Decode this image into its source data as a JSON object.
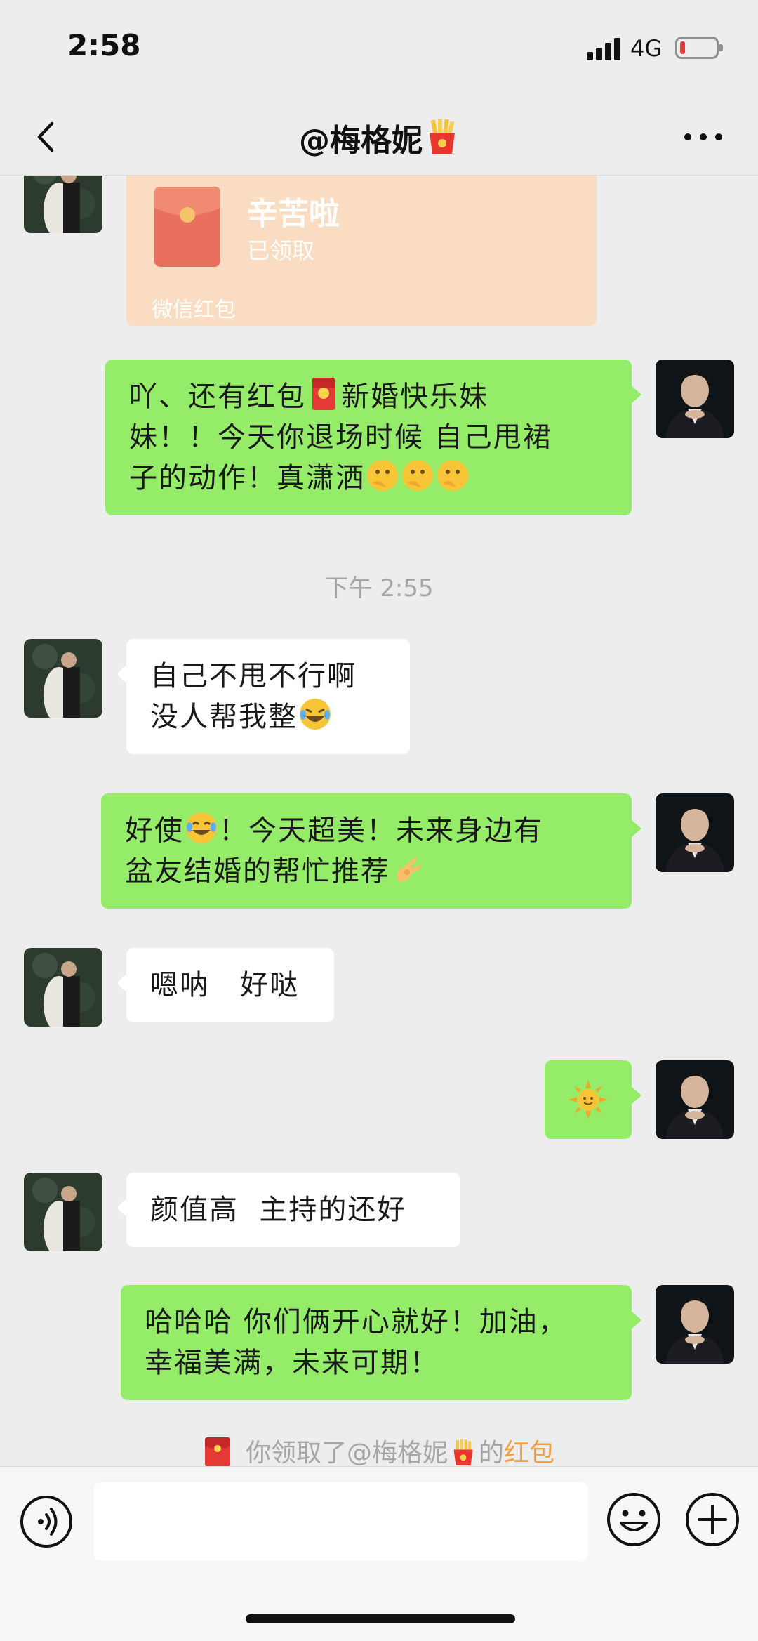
{
  "status_bar": {
    "time": "2:58",
    "network": "4G"
  },
  "nav": {
    "title": "@梅格妮"
  },
  "red_packet": {
    "title": "辛苦啦",
    "status": "已领取",
    "footer": "微信红包"
  },
  "messages": [
    {
      "dir": "out",
      "lines": [
        "吖、还有红包",
        "新婚快乐妹",
        "妹！！今天你退场时候 自己甩裙",
        "子的动作！真潇洒"
      ]
    },
    {
      "dir": "in",
      "lines": [
        "自己不甩不行啊",
        "没人帮我整"
      ]
    },
    {
      "dir": "out",
      "lines": [
        "好使",
        "！今天超美！未来身边有",
        "盆友结婚的帮忙推荐"
      ]
    },
    {
      "dir": "in",
      "lines": [
        "嗯呐   好哒"
      ]
    },
    {
      "dir": "in",
      "lines": [
        "颜值高  主持的还好"
      ]
    },
    {
      "dir": "out",
      "lines": [
        "哈哈哈 你们俩开心就好！加油，",
        "幸福美满，未来可期！"
      ]
    }
  ],
  "timestamp": "下午 2:55",
  "system_note": {
    "prefix": "你领取了@梅格妮",
    "middle": "的",
    "link": "红包"
  },
  "colors": {
    "out_bubble": "#95ec69",
    "in_bubble": "#ffffff",
    "background": "#ededed",
    "link": "#f0a040"
  },
  "icons": {
    "back": "chevron-left-icon",
    "more": "more-dots-icon",
    "voice": "voice-icon",
    "emoji": "emoji-icon",
    "plus": "plus-icon",
    "fries": "fries-emoji",
    "red_envelope": "red-envelope-icon",
    "sun": "sun-emoji"
  }
}
